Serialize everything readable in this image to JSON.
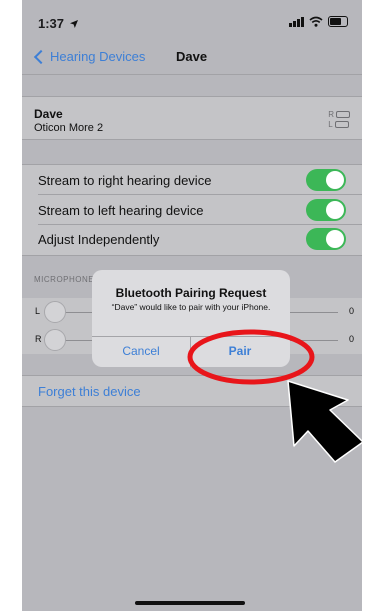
{
  "status_bar": {
    "time": "1:37"
  },
  "nav": {
    "back_label": "Hearing Devices",
    "title": "Dave"
  },
  "device": {
    "name": "Dave",
    "model": "Oticon More 2",
    "right_label": "R",
    "left_label": "L"
  },
  "settings": [
    {
      "label": "Stream to right hearing device",
      "on": true
    },
    {
      "label": "Stream to left hearing device",
      "on": true
    },
    {
      "label": "Adjust Independently",
      "on": true
    }
  ],
  "microphone": {
    "section_label": "MICROPHONE",
    "sliders": [
      {
        "side": "L",
        "value": "0"
      },
      {
        "side": "R",
        "value": "0"
      }
    ]
  },
  "forget_label": "Forget this device",
  "alert": {
    "title": "Bluetooth Pairing Request",
    "message": "“Dave” would like to pair with your iPhone.",
    "cancel_label": "Cancel",
    "pair_label": "Pair"
  },
  "colors": {
    "accent": "#3d7fd6",
    "toggle_on": "#3cb757",
    "annotation_circle": "#e8151a",
    "annotation_arrow": "#000000"
  },
  "icons": [
    "location-arrow-icon",
    "signal-icon",
    "wifi-icon",
    "battery-icon",
    "chevron-left-icon",
    "hearing-device-battery-icon"
  ]
}
